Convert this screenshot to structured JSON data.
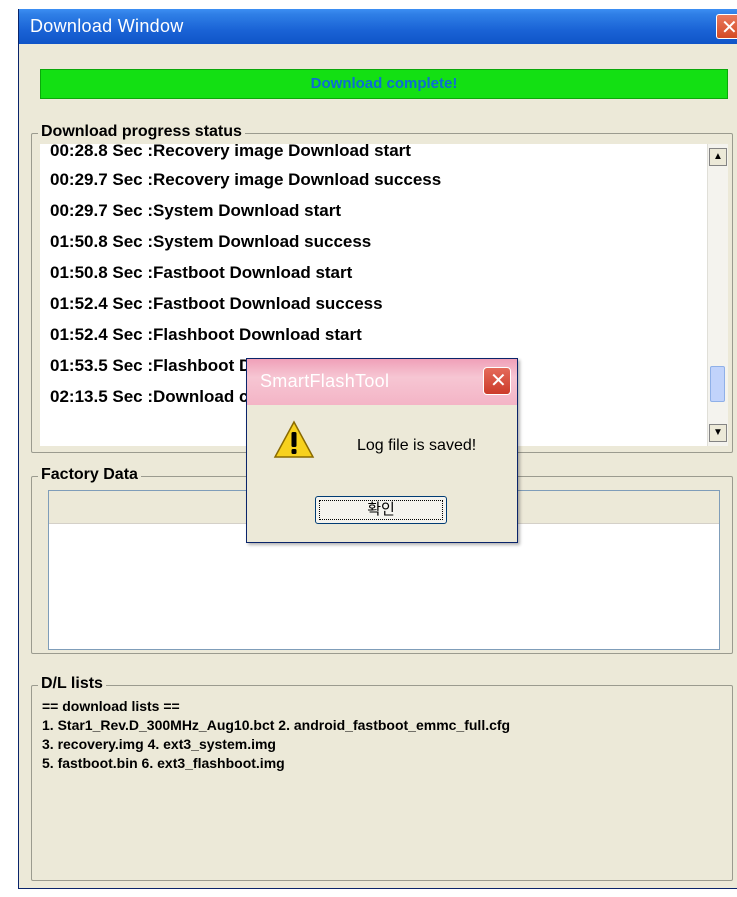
{
  "window": {
    "title": "Download Window",
    "close_glyph": "✕"
  },
  "progress": {
    "status_text": "Download complete!",
    "fill_fraction": 1.0,
    "color": "#13e013"
  },
  "status_group": {
    "legend": "Download progress status",
    "log_lines": [
      "00:28.8 Sec  :Recovery image Download start",
      "00:29.7 Sec  :Recovery image Download success",
      "00:29.7 Sec  :System Download start",
      "01:50.8 Sec  :System Download success",
      "01:50.8 Sec  :Fastboot Download start",
      "01:52.4 Sec  :Fastboot Download success",
      "01:52.4 Sec  :Flashboot Download start",
      "01:53.5 Sec  :Flashboot Download success",
      "02:13.5 Sec  :Download complete!"
    ]
  },
  "factory_group": {
    "legend": "Factory Data"
  },
  "lists_group": {
    "legend": "D/L lists",
    "lines": [
      "==  download lists  ==",
      "1. Star1_Rev.D_300MHz_Aug10.bct    2. android_fastboot_emmc_full.cfg",
      "3. recovery.img    4. ext3_system.img",
      "5. fastboot.bin    6. ext3_flashboot.img"
    ]
  },
  "dialog": {
    "title": "SmartFlashTool",
    "message": "Log file is saved!",
    "ok_label": "확인",
    "icon": "warning-icon"
  }
}
